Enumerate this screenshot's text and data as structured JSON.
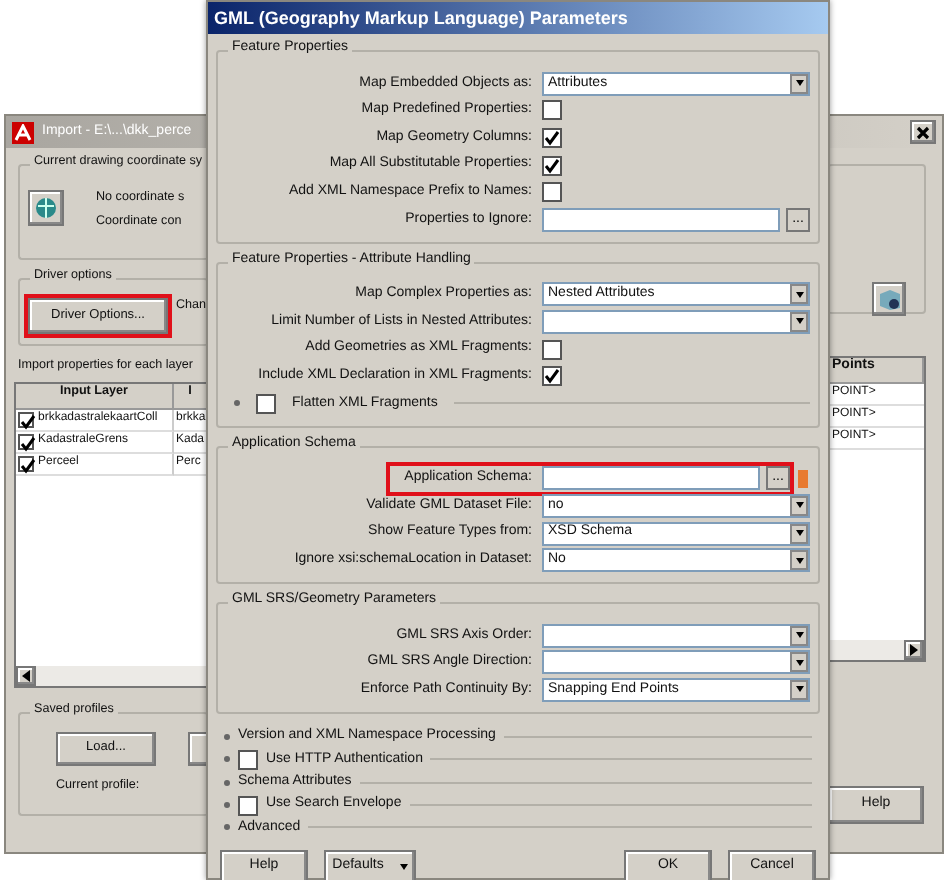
{
  "import_window": {
    "title": "Import - E:\\...\\dkk_perce",
    "coordinate_group": {
      "title": "Current drawing coordinate sy",
      "line_1": "No coordinate s",
      "line_2": "Coordinate con"
    },
    "driver_options": {
      "title": "Driver options",
      "button": "Driver Options...",
      "highlighted": true,
      "note": "Chan"
    },
    "layers_caption": "Import properties for each layer",
    "table": {
      "columns": [
        "Input Layer",
        "I"
      ],
      "rows": [
        {
          "checked": true,
          "cells": [
            "brkkadastralekaartColl",
            "brkka"
          ]
        },
        {
          "checked": true,
          "cells": [
            "KadastraleGrens",
            "Kada"
          ]
        },
        {
          "checked": true,
          "cells": [
            "Perceel",
            "Perc"
          ]
        }
      ]
    },
    "points_column": {
      "header": "Points",
      "cells": [
        "POINT>",
        "POINT>",
        "POINT>"
      ]
    },
    "saved_profiles": {
      "title": "Saved profiles",
      "load_button": "Load...",
      "current_profile": "Current profile:"
    },
    "help_button": "Help"
  },
  "gml_window": {
    "title": "GML (Geography Markup Language) Parameters",
    "groups": [
      {
        "title": "Feature Properties",
        "rows": [
          {
            "kind": "select",
            "label": "Map Embedded Objects as:",
            "value": "Attributes"
          },
          {
            "kind": "check",
            "label": "Map Predefined Properties:",
            "checked": false
          },
          {
            "kind": "check",
            "label": "Map Geometry Columns:",
            "checked": true
          },
          {
            "kind": "check",
            "label": "Map All Substitutable Properties:",
            "checked": true
          },
          {
            "kind": "check",
            "label": "Add XML Namespace Prefix to Names:",
            "checked": false
          },
          {
            "kind": "text",
            "label": "Properties to Ignore:",
            "browse": "..."
          }
        ]
      },
      {
        "title": "Feature Properties - Attribute Handling",
        "rows": [
          {
            "kind": "select",
            "label": "Map Complex Properties as:",
            "value": "Nested Attributes"
          },
          {
            "kind": "select",
            "label": "Limit Number of Lists in Nested Attributes:"
          },
          {
            "kind": "check",
            "label": "Add Geometries as XML Fragments:",
            "checked": false
          },
          {
            "kind": "check",
            "label": "Include XML Declaration in XML Fragments:",
            "checked": true
          },
          {
            "kind": "option",
            "label": "Flatten XML Fragments",
            "checked": false
          }
        ]
      },
      {
        "title": "Application Schema",
        "rows": [
          {
            "kind": "text",
            "label": "Application Schema:",
            "browse": "...",
            "highlighted": true
          },
          {
            "kind": "select",
            "label": "Validate GML Dataset File:",
            "value": "no"
          },
          {
            "kind": "select",
            "label": "Show Feature Types from:",
            "value": "XSD Schema"
          },
          {
            "kind": "select",
            "label": "Ignore xsi:schemaLocation in Dataset:",
            "value": "No"
          }
        ]
      },
      {
        "title": "GML SRS/Geometry Parameters",
        "rows": [
          {
            "kind": "select",
            "label": "GML SRS Axis Order:"
          },
          {
            "kind": "select",
            "label": "GML SRS Angle Direction:"
          },
          {
            "kind": "select",
            "label": "Enforce Path Continuity By:",
            "value": "Snapping End Points"
          }
        ]
      }
    ],
    "sections": [
      {
        "kind": "expander",
        "label": "Version and XML Namespace Processing"
      },
      {
        "kind": "option",
        "label": "Use HTTP Authentication",
        "checked": false
      },
      {
        "kind": "expander",
        "label": "Schema Attributes"
      },
      {
        "kind": "option",
        "label": "Use Search Envelope",
        "checked": false
      },
      {
        "kind": "expander",
        "label": "Advanced"
      }
    ],
    "buttons": [
      {
        "kind": "plain",
        "label": "Help"
      },
      {
        "kind": "menu",
        "label": "Defaults"
      },
      {
        "kind": "spacer"
      },
      {
        "kind": "plain",
        "label": "OK"
      },
      {
        "kind": "plain",
        "label": "Cancel"
      }
    ]
  }
}
